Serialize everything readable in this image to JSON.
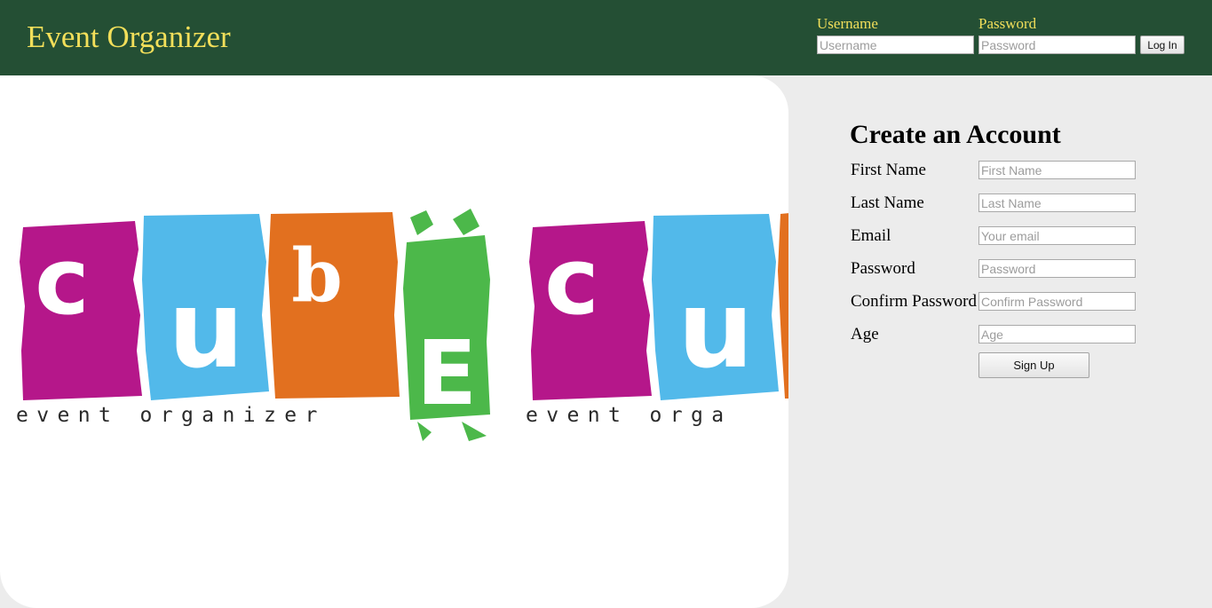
{
  "header": {
    "title": "Event Organizer",
    "username_label": "Username",
    "username_placeholder": "Username",
    "password_label": "Password",
    "password_placeholder": "Password",
    "login_button": "Log In"
  },
  "banner": {
    "logo_text": "event organizer",
    "logo_letters": [
      "c",
      "u",
      "b",
      "E"
    ],
    "repeated_logo_letters": [
      "c",
      "u"
    ],
    "repeated_logo_text": "event orga",
    "colors": {
      "magenta": "#b5178a",
      "cyan": "#52b9ea",
      "orange": "#e2701f",
      "green": "#4cb84a"
    }
  },
  "signup": {
    "title": "Create an Account",
    "fields": [
      {
        "label": "First Name",
        "placeholder": "First Name"
      },
      {
        "label": "Last Name",
        "placeholder": "Last Name"
      },
      {
        "label": "Email",
        "placeholder": "Your email"
      },
      {
        "label": "Password",
        "placeholder": "Password"
      },
      {
        "label": "Confirm Password",
        "placeholder": "Confirm Password"
      },
      {
        "label": "Age",
        "placeholder": "Age"
      }
    ],
    "submit_button": "Sign Up"
  },
  "colors": {
    "header_bg": "#244f34",
    "header_text": "#f2df5a",
    "page_bg": "#ececec"
  }
}
